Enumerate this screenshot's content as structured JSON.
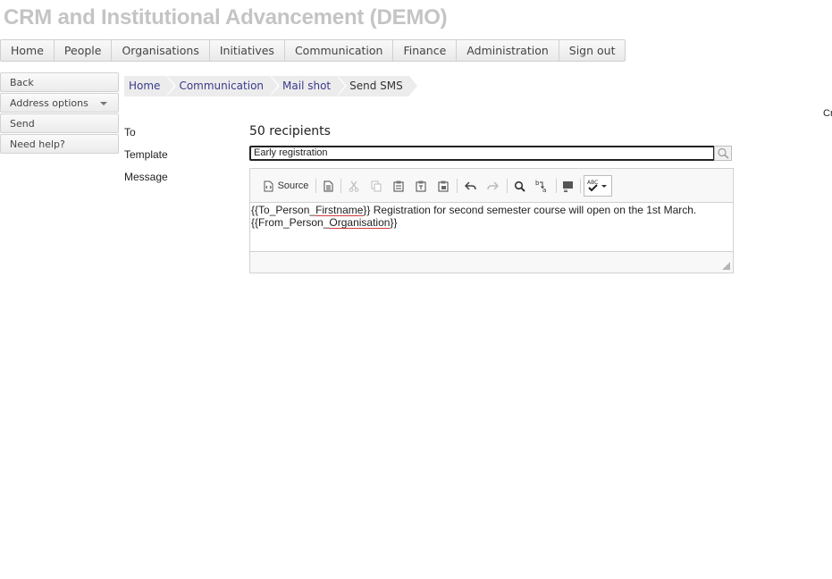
{
  "app": {
    "title": "CRM and Institutional Advancement (DEMO)"
  },
  "topnav": {
    "items": [
      "Home",
      "People",
      "Organisations",
      "Initiatives",
      "Communication",
      "Finance",
      "Administration",
      "Sign out"
    ]
  },
  "sidebar": {
    "back": "Back",
    "address_options": "Address options",
    "send": "Send",
    "help": "Need help?"
  },
  "breadcrumb": [
    "Home",
    "Communication",
    "Mail shot",
    "Send SMS"
  ],
  "edge_text": "Cr",
  "form": {
    "to_label": "To",
    "to_value": "50 recipients",
    "template_label": "Template",
    "template_value": "Early registration",
    "message_label": "Message"
  },
  "editor": {
    "source_label": "Source",
    "line1": {
      "pre": "{{To_Person_",
      "word": "Firstname",
      "post": "}} Registration for second semester course will open on the 1st March."
    },
    "line2": {
      "pre": "{{From_Person_",
      "word": "Organisation",
      "post": "}}"
    },
    "spellcheck_label": "ABC"
  },
  "colors": {
    "title": "#c4c4c4",
    "breadcrumb_link": "#3a3a8c",
    "spell_error": "#d43a3a"
  }
}
